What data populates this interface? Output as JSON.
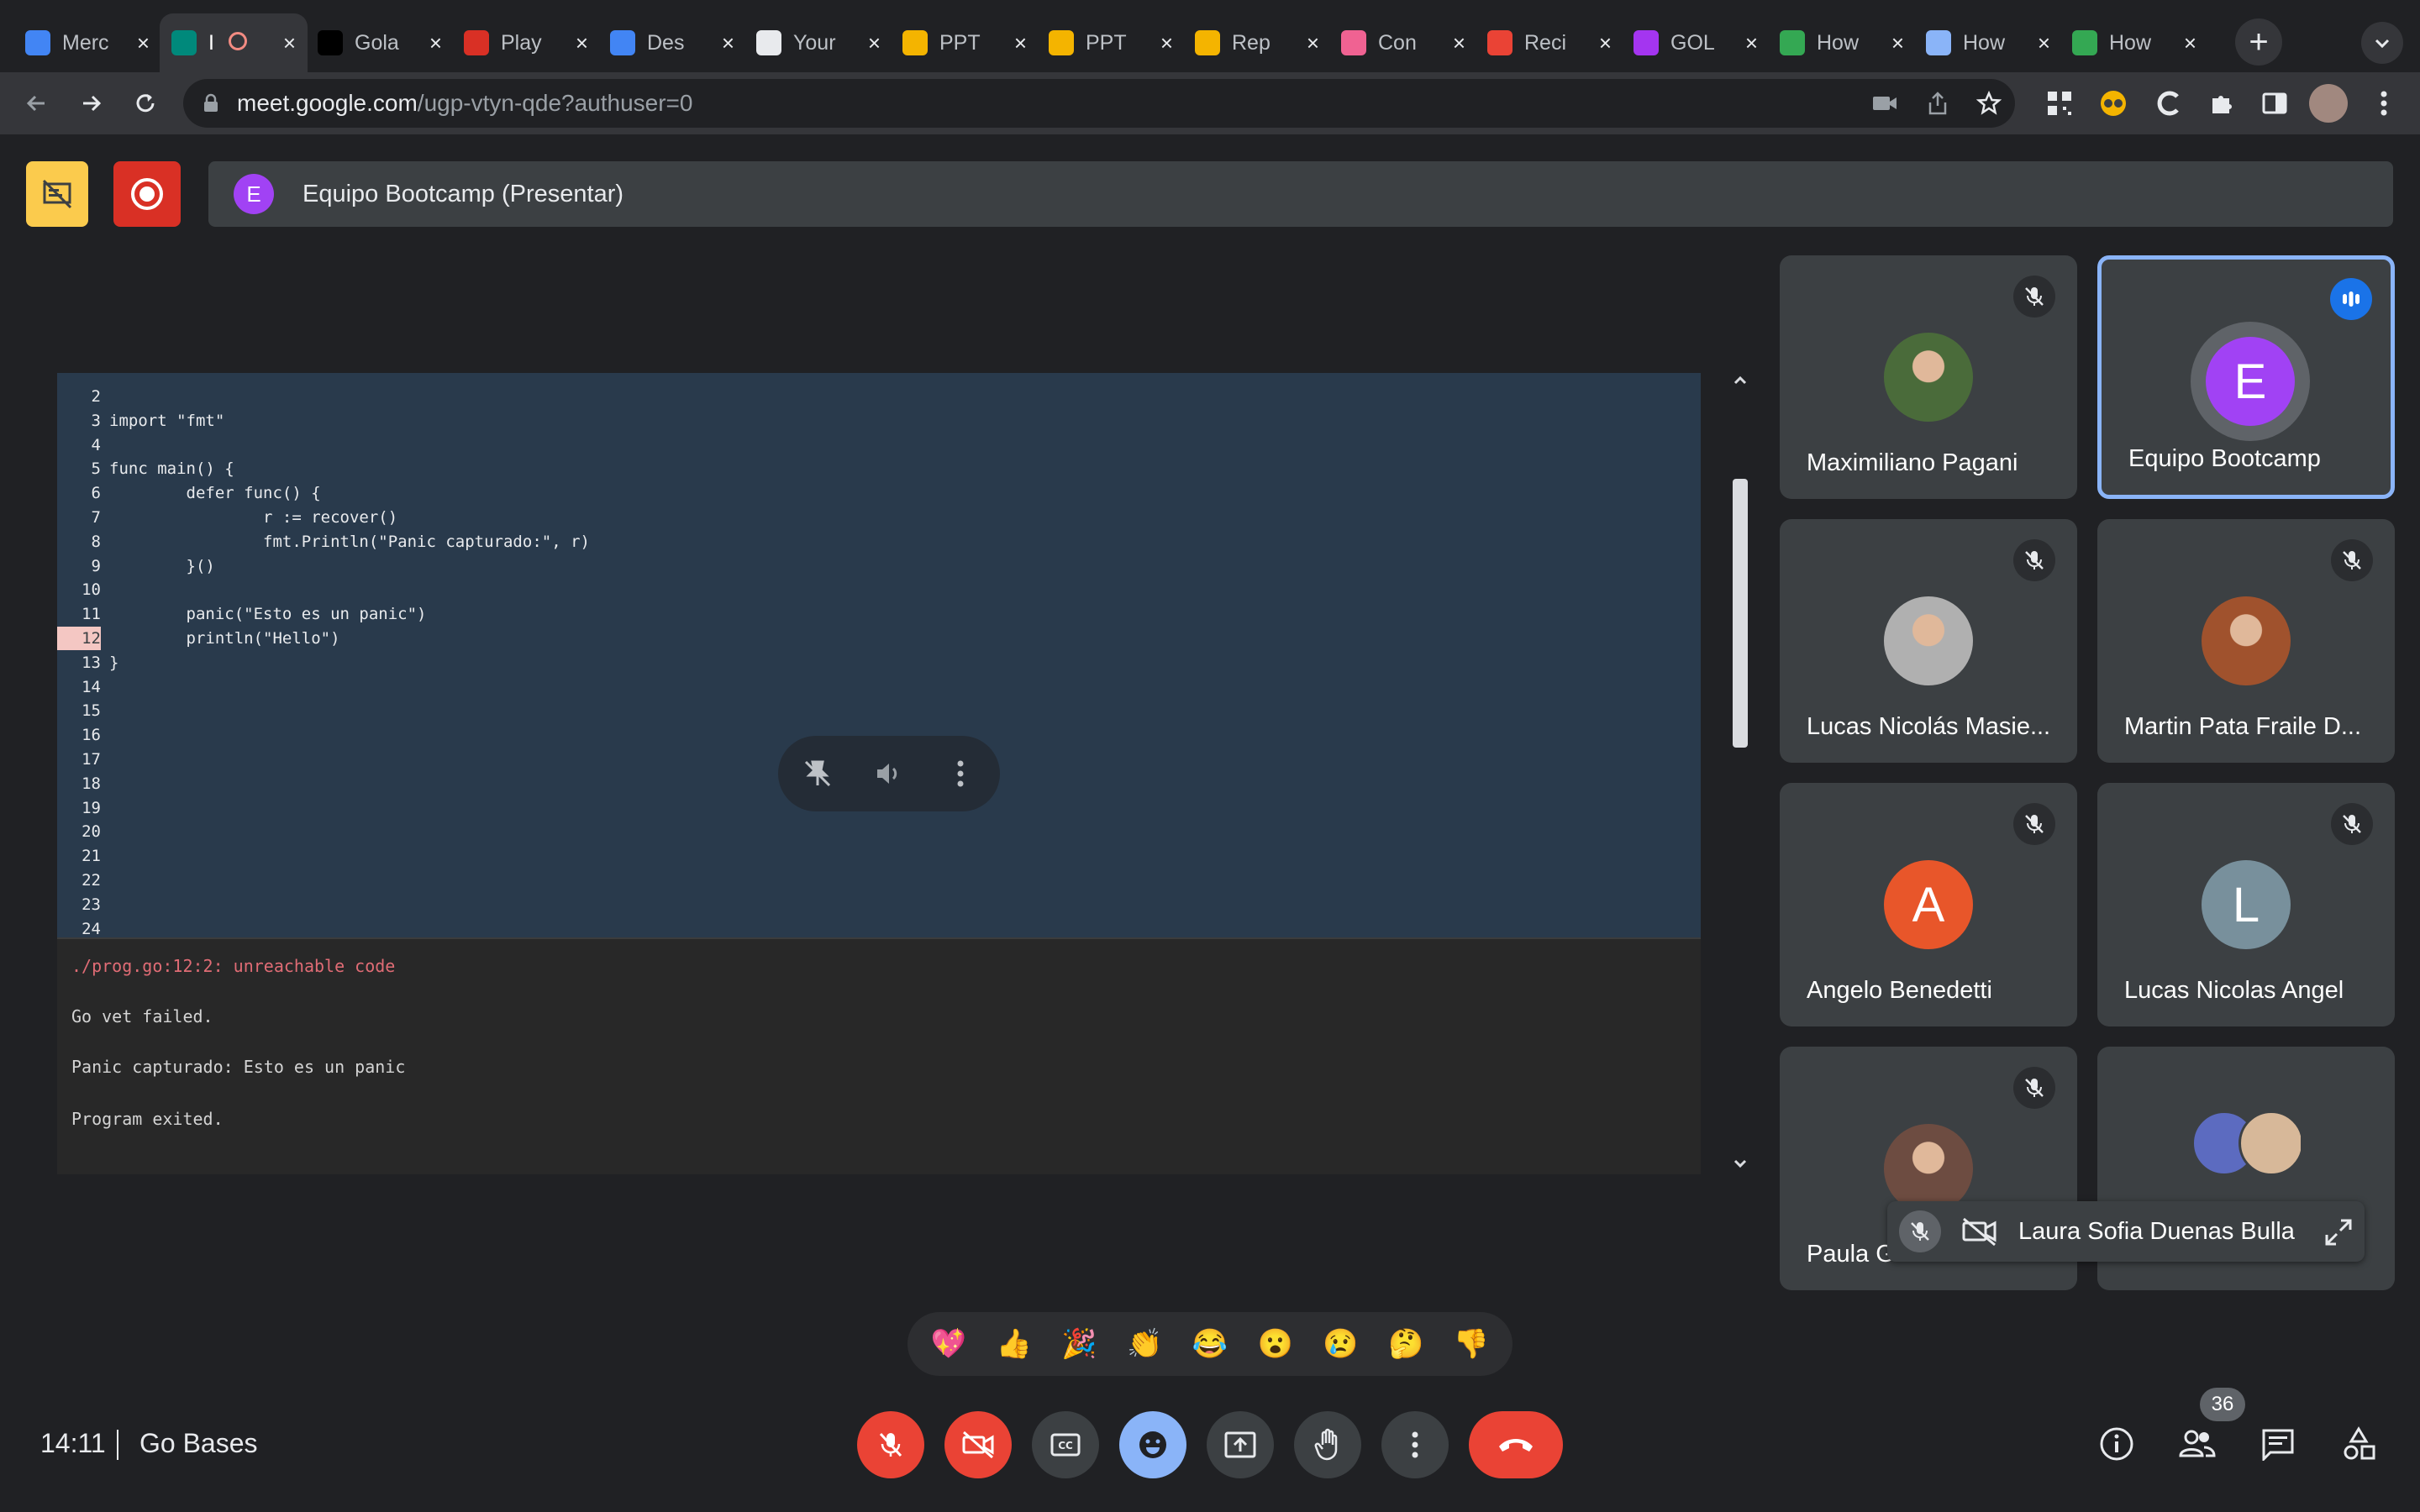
{
  "browser": {
    "tabs": [
      {
        "label": "Merc",
        "favicon": "calendar-icon",
        "color": "#4285f4"
      },
      {
        "label": "I",
        "favicon": "meet-icon",
        "color": "#00897b",
        "active": true
      },
      {
        "label": "Gola",
        "favicon": "medium-icon",
        "color": "#000000"
      },
      {
        "label": "Play",
        "favicon": "play-icon",
        "color": "#d93025"
      },
      {
        "label": "Des",
        "favicon": "docs-icon",
        "color": "#4285f4"
      },
      {
        "label": "Your",
        "favicon": "github-icon",
        "color": "#e8eaed"
      },
      {
        "label": "PPT",
        "favicon": "slides-icon",
        "color": "#f4b400"
      },
      {
        "label": "PPT",
        "favicon": "slides-icon",
        "color": "#f4b400"
      },
      {
        "label": "Rep",
        "favicon": "slides-icon",
        "color": "#f4b400"
      },
      {
        "label": "Con",
        "favicon": "record-icon",
        "color": "#f06292"
      },
      {
        "label": "Reci",
        "favicon": "gmail-icon",
        "color": "#ea4335"
      },
      {
        "label": "GOL",
        "favicon": "udemy-icon",
        "color": "#a435f0"
      },
      {
        "label": "How",
        "favicon": "link-icon",
        "color": "#34a853"
      },
      {
        "label": "How",
        "favicon": "cloud-icon",
        "color": "#8ab4f8"
      },
      {
        "label": "How",
        "favicon": "link-icon",
        "color": "#34a853"
      }
    ],
    "url_host": "meet.google.com",
    "url_path": "/ugp-vtyn-qde?authuser=0"
  },
  "meet": {
    "presenter_initial": "E",
    "presentation_title": "Equipo Bootcamp (Presentar)",
    "clock": "14:11",
    "meeting_name": "Go Bases",
    "participant_count": "36"
  },
  "code": {
    "lines": [
      {
        "n": "2",
        "t": ""
      },
      {
        "n": "3",
        "t": "import \"fmt\""
      },
      {
        "n": "4",
        "t": ""
      },
      {
        "n": "5",
        "t": "func main() {"
      },
      {
        "n": "6",
        "t": "        defer func() {"
      },
      {
        "n": "7",
        "t": "                r := recover()"
      },
      {
        "n": "8",
        "t": "                fmt.Println(\"Panic capturado:\", r)"
      },
      {
        "n": "9",
        "t": "        }()"
      },
      {
        "n": "10",
        "t": ""
      },
      {
        "n": "11",
        "t": "        panic(\"Esto es un panic\")"
      },
      {
        "n": "12",
        "t": "        println(\"Hello\")",
        "hl": true
      },
      {
        "n": "13",
        "t": "}"
      },
      {
        "n": "14",
        "t": ""
      },
      {
        "n": "15",
        "t": ""
      },
      {
        "n": "16",
        "t": ""
      },
      {
        "n": "17",
        "t": ""
      },
      {
        "n": "18",
        "t": ""
      },
      {
        "n": "19",
        "t": ""
      },
      {
        "n": "20",
        "t": ""
      },
      {
        "n": "21",
        "t": ""
      },
      {
        "n": "22",
        "t": ""
      },
      {
        "n": "23",
        "t": ""
      },
      {
        "n": "24",
        "t": ""
      }
    ],
    "output": [
      {
        "t": "./prog.go:12:2: unreachable code",
        "color": "#e06c75"
      },
      {
        "t": "Go vet failed.",
        "color": "#d4d4d4"
      },
      {
        "t": "Panic capturado: Esto es un panic",
        "color": "#d4d4d4"
      },
      {
        "t": "Program exited.",
        "color": "#d4d4d4"
      }
    ]
  },
  "participants": [
    {
      "name": "Maximiliano Pagani",
      "avatar": "photo",
      "bg": "#4a6b3a",
      "muted": true
    },
    {
      "name": "Equipo Bootcamp",
      "avatar": "E",
      "bg": "#a142f4",
      "speaking": true
    },
    {
      "name": "Lucas Nicolás Masie...",
      "avatar": "photo",
      "bg": "#b0b0b0",
      "muted": true
    },
    {
      "name": "Martin Pata Fraile D...",
      "avatar": "photo",
      "bg": "#a0522d",
      "muted": true
    },
    {
      "name": "Angelo Benedetti",
      "avatar": "A",
      "bg": "#e8562a",
      "muted": true
    },
    {
      "name": "Lucas Nicolas Angel",
      "avatar": "L",
      "bg": "#78909c",
      "muted": true
    },
    {
      "name": "Paula G",
      "avatar": "photo",
      "bg": "#6d4c41",
      "muted": true
    },
    {
      "name": "",
      "avatar": "group",
      "bg": "#5c6bc0"
    }
  ],
  "floating_card": {
    "name": "Laura Sofia Duenas Bulla"
  },
  "reactions": [
    "💖",
    "👍",
    "🎉",
    "👏",
    "😂",
    "😮",
    "😢",
    "🤔",
    "👎"
  ]
}
